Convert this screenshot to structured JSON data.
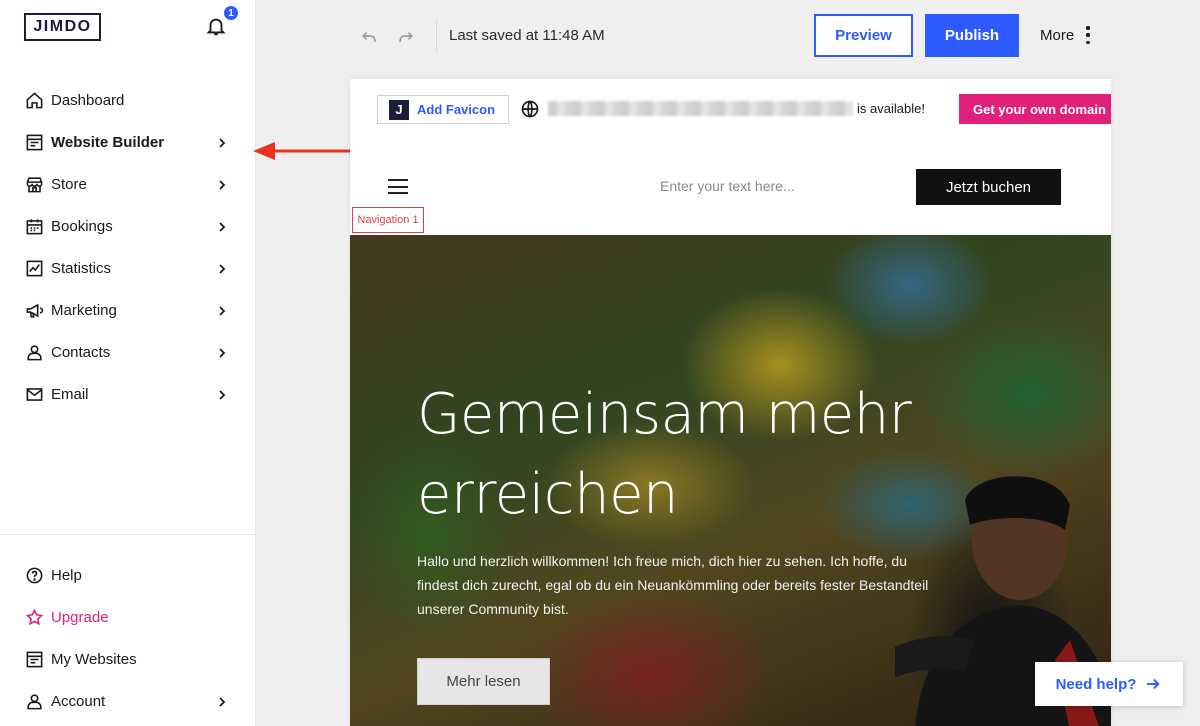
{
  "sidebar": {
    "logo": "JIMDO",
    "notification_count": "1",
    "items": [
      {
        "label": "Dashboard",
        "icon": "home-icon",
        "chevron": false
      },
      {
        "label": "Website Builder",
        "icon": "website-builder-icon",
        "chevron": true,
        "active": true
      },
      {
        "label": "Store",
        "icon": "store-icon",
        "chevron": true
      },
      {
        "label": "Bookings",
        "icon": "calendar-icon",
        "chevron": true
      },
      {
        "label": "Statistics",
        "icon": "chart-icon",
        "chevron": true
      },
      {
        "label": "Marketing",
        "icon": "megaphone-icon",
        "chevron": true
      },
      {
        "label": "Contacts",
        "icon": "person-icon",
        "chevron": true
      },
      {
        "label": "Email",
        "icon": "mail-icon",
        "chevron": true
      }
    ],
    "bottom_items": [
      {
        "label": "Help",
        "icon": "help-icon",
        "chevron": false
      },
      {
        "label": "Upgrade",
        "icon": "star-icon",
        "chevron": false,
        "color": "#e0207a"
      },
      {
        "label": "My Websites",
        "icon": "my-websites-icon",
        "chevron": false
      },
      {
        "label": "Account",
        "icon": "account-icon",
        "chevron": true
      }
    ]
  },
  "toolbar": {
    "saved_text": "Last saved at 11:48 AM",
    "preview_label": "Preview",
    "publish_label": "Publish",
    "more_label": "More"
  },
  "site": {
    "favicon_label": "Add Favicon",
    "favicon_letter": "J",
    "available_text": "is available!",
    "domain_button": "Get your own domain",
    "search_placeholder": "Enter your text here...",
    "book_button": "Jetzt buchen",
    "nav_tag": "Navigation 1",
    "hero_title": "Gemeinsam mehr erreichen",
    "hero_text": "Hallo und herzlich willkommen! Ich freue mich, dich hier zu sehen. Ich hoffe, du findest dich zurecht, egal ob du ein Neuankömmling oder bereits fester Bestandteil unserer Community bist.",
    "hero_button": "Mehr lesen"
  },
  "help_button": "Need help?",
  "colors": {
    "accent_blue": "#2d5bff",
    "brand_pink": "#e0207a",
    "annotation_red": "#e8321e"
  }
}
